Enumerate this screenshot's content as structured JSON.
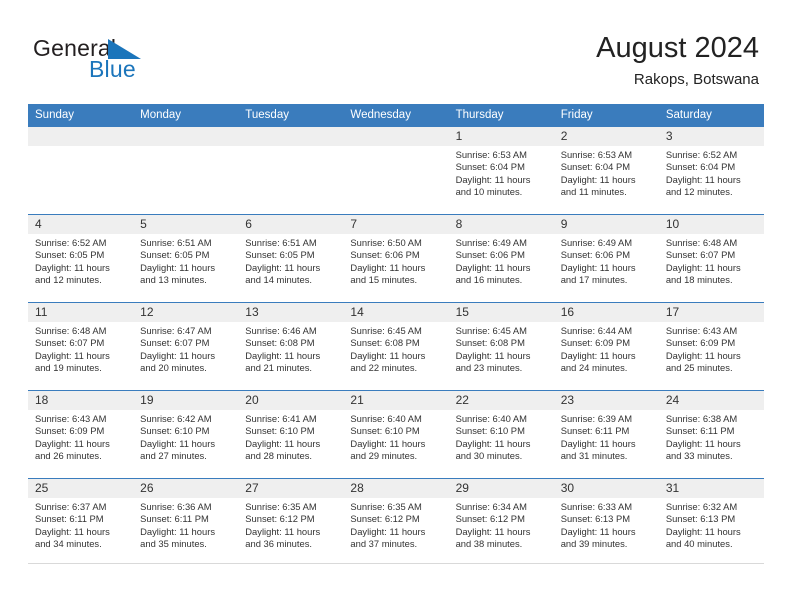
{
  "brand": {
    "name_part1": "General",
    "name_part2": "Blue",
    "logo_icon": "triangle-flag-icon",
    "color_dark": "#231f20",
    "color_blue": "#1b75bb"
  },
  "header": {
    "title": "August 2024",
    "subtitle": "Rakops, Botswana"
  },
  "theme": {
    "header_bar": "#3a7cbd",
    "daynum_strip": "#efefef",
    "row_divider": "#3a7cbd",
    "text": "#333333"
  },
  "weekday_headers": [
    "Sunday",
    "Monday",
    "Tuesday",
    "Wednesday",
    "Thursday",
    "Friday",
    "Saturday"
  ],
  "weeks": [
    [
      {
        "day": "",
        "lines": []
      },
      {
        "day": "",
        "lines": []
      },
      {
        "day": "",
        "lines": []
      },
      {
        "day": "",
        "lines": []
      },
      {
        "day": "1",
        "lines": [
          "Sunrise: 6:53 AM",
          "Sunset: 6:04 PM",
          "Daylight: 11 hours",
          "and 10 minutes."
        ]
      },
      {
        "day": "2",
        "lines": [
          "Sunrise: 6:53 AM",
          "Sunset: 6:04 PM",
          "Daylight: 11 hours",
          "and 11 minutes."
        ]
      },
      {
        "day": "3",
        "lines": [
          "Sunrise: 6:52 AM",
          "Sunset: 6:04 PM",
          "Daylight: 11 hours",
          "and 12 minutes."
        ]
      }
    ],
    [
      {
        "day": "4",
        "lines": [
          "Sunrise: 6:52 AM",
          "Sunset: 6:05 PM",
          "Daylight: 11 hours",
          "and 12 minutes."
        ]
      },
      {
        "day": "5",
        "lines": [
          "Sunrise: 6:51 AM",
          "Sunset: 6:05 PM",
          "Daylight: 11 hours",
          "and 13 minutes."
        ]
      },
      {
        "day": "6",
        "lines": [
          "Sunrise: 6:51 AM",
          "Sunset: 6:05 PM",
          "Daylight: 11 hours",
          "and 14 minutes."
        ]
      },
      {
        "day": "7",
        "lines": [
          "Sunrise: 6:50 AM",
          "Sunset: 6:06 PM",
          "Daylight: 11 hours",
          "and 15 minutes."
        ]
      },
      {
        "day": "8",
        "lines": [
          "Sunrise: 6:49 AM",
          "Sunset: 6:06 PM",
          "Daylight: 11 hours",
          "and 16 minutes."
        ]
      },
      {
        "day": "9",
        "lines": [
          "Sunrise: 6:49 AM",
          "Sunset: 6:06 PM",
          "Daylight: 11 hours",
          "and 17 minutes."
        ]
      },
      {
        "day": "10",
        "lines": [
          "Sunrise: 6:48 AM",
          "Sunset: 6:07 PM",
          "Daylight: 11 hours",
          "and 18 minutes."
        ]
      }
    ],
    [
      {
        "day": "11",
        "lines": [
          "Sunrise: 6:48 AM",
          "Sunset: 6:07 PM",
          "Daylight: 11 hours",
          "and 19 minutes."
        ]
      },
      {
        "day": "12",
        "lines": [
          "Sunrise: 6:47 AM",
          "Sunset: 6:07 PM",
          "Daylight: 11 hours",
          "and 20 minutes."
        ]
      },
      {
        "day": "13",
        "lines": [
          "Sunrise: 6:46 AM",
          "Sunset: 6:08 PM",
          "Daylight: 11 hours",
          "and 21 minutes."
        ]
      },
      {
        "day": "14",
        "lines": [
          "Sunrise: 6:45 AM",
          "Sunset: 6:08 PM",
          "Daylight: 11 hours",
          "and 22 minutes."
        ]
      },
      {
        "day": "15",
        "lines": [
          "Sunrise: 6:45 AM",
          "Sunset: 6:08 PM",
          "Daylight: 11 hours",
          "and 23 minutes."
        ]
      },
      {
        "day": "16",
        "lines": [
          "Sunrise: 6:44 AM",
          "Sunset: 6:09 PM",
          "Daylight: 11 hours",
          "and 24 minutes."
        ]
      },
      {
        "day": "17",
        "lines": [
          "Sunrise: 6:43 AM",
          "Sunset: 6:09 PM",
          "Daylight: 11 hours",
          "and 25 minutes."
        ]
      }
    ],
    [
      {
        "day": "18",
        "lines": [
          "Sunrise: 6:43 AM",
          "Sunset: 6:09 PM",
          "Daylight: 11 hours",
          "and 26 minutes."
        ]
      },
      {
        "day": "19",
        "lines": [
          "Sunrise: 6:42 AM",
          "Sunset: 6:10 PM",
          "Daylight: 11 hours",
          "and 27 minutes."
        ]
      },
      {
        "day": "20",
        "lines": [
          "Sunrise: 6:41 AM",
          "Sunset: 6:10 PM",
          "Daylight: 11 hours",
          "and 28 minutes."
        ]
      },
      {
        "day": "21",
        "lines": [
          "Sunrise: 6:40 AM",
          "Sunset: 6:10 PM",
          "Daylight: 11 hours",
          "and 29 minutes."
        ]
      },
      {
        "day": "22",
        "lines": [
          "Sunrise: 6:40 AM",
          "Sunset: 6:10 PM",
          "Daylight: 11 hours",
          "and 30 minutes."
        ]
      },
      {
        "day": "23",
        "lines": [
          "Sunrise: 6:39 AM",
          "Sunset: 6:11 PM",
          "Daylight: 11 hours",
          "and 31 minutes."
        ]
      },
      {
        "day": "24",
        "lines": [
          "Sunrise: 6:38 AM",
          "Sunset: 6:11 PM",
          "Daylight: 11 hours",
          "and 33 minutes."
        ]
      }
    ],
    [
      {
        "day": "25",
        "lines": [
          "Sunrise: 6:37 AM",
          "Sunset: 6:11 PM",
          "Daylight: 11 hours",
          "and 34 minutes."
        ]
      },
      {
        "day": "26",
        "lines": [
          "Sunrise: 6:36 AM",
          "Sunset: 6:11 PM",
          "Daylight: 11 hours",
          "and 35 minutes."
        ]
      },
      {
        "day": "27",
        "lines": [
          "Sunrise: 6:35 AM",
          "Sunset: 6:12 PM",
          "Daylight: 11 hours",
          "and 36 minutes."
        ]
      },
      {
        "day": "28",
        "lines": [
          "Sunrise: 6:35 AM",
          "Sunset: 6:12 PM",
          "Daylight: 11 hours",
          "and 37 minutes."
        ]
      },
      {
        "day": "29",
        "lines": [
          "Sunrise: 6:34 AM",
          "Sunset: 6:12 PM",
          "Daylight: 11 hours",
          "and 38 minutes."
        ]
      },
      {
        "day": "30",
        "lines": [
          "Sunrise: 6:33 AM",
          "Sunset: 6:13 PM",
          "Daylight: 11 hours",
          "and 39 minutes."
        ]
      },
      {
        "day": "31",
        "lines": [
          "Sunrise: 6:32 AM",
          "Sunset: 6:13 PM",
          "Daylight: 11 hours",
          "and 40 minutes."
        ]
      }
    ]
  ]
}
